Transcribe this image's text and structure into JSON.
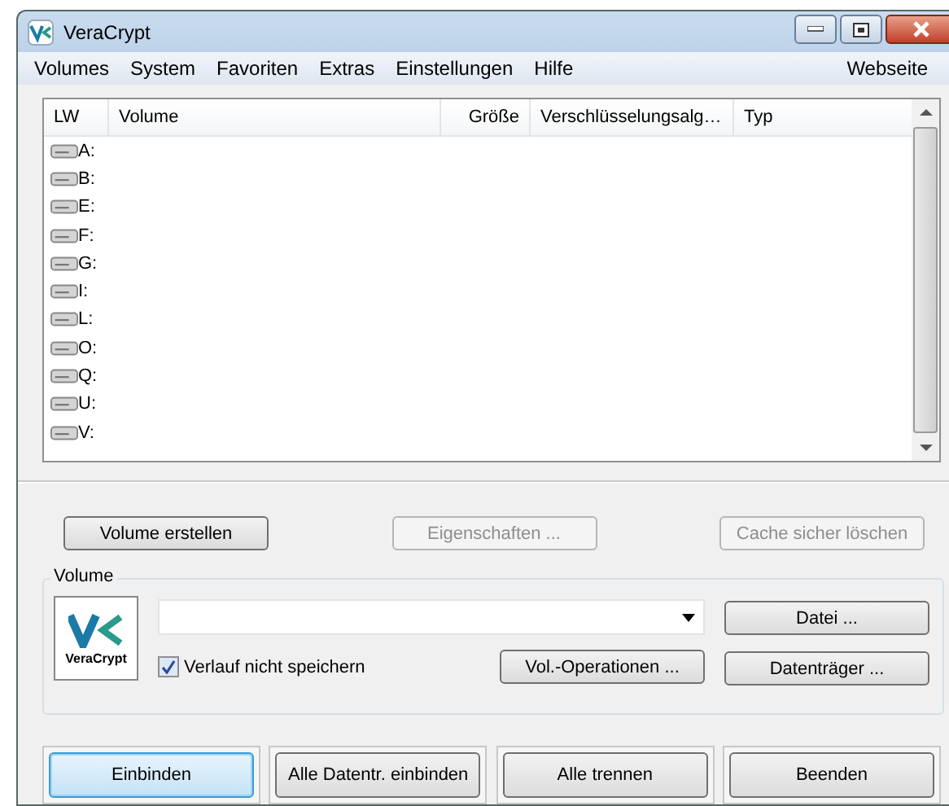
{
  "window": {
    "title": "VeraCrypt"
  },
  "menu": [
    "Volumes",
    "System",
    "Favoriten",
    "Extras",
    "Einstellungen",
    "Hilfe"
  ],
  "menu_right": "Webseite",
  "table": {
    "columns": [
      "LW",
      "Volume",
      "Größe",
      "Verschlüsselungsalg…",
      "Typ"
    ],
    "rows": [
      "A:",
      "B:",
      "E:",
      "F:",
      "G:",
      "I:",
      "L:",
      "O:",
      "Q:",
      "U:",
      "V:"
    ]
  },
  "actions": [
    {
      "label": "Volume erstellen",
      "disabled": false
    },
    {
      "label": "Eigenschaften ...",
      "disabled": true
    },
    {
      "label": "Cache sicher löschen",
      "disabled": true
    }
  ],
  "volume": {
    "legend": "Volume",
    "logo": "VeraCrypt",
    "history_checkbox": {
      "label": "Verlauf nicht speichern",
      "checked": true
    },
    "file_button": "Datei ...",
    "ops_button": "Vol.-Operationen ...",
    "device_button": "Datenträger ..."
  },
  "bottom_buttons": [
    {
      "label": "Einbinden",
      "default": true
    },
    {
      "label": "Alle Datentr. einbinden",
      "default": false
    },
    {
      "label": "Alle trennen",
      "default": false
    },
    {
      "label": "Beenden",
      "default": false
    }
  ]
}
